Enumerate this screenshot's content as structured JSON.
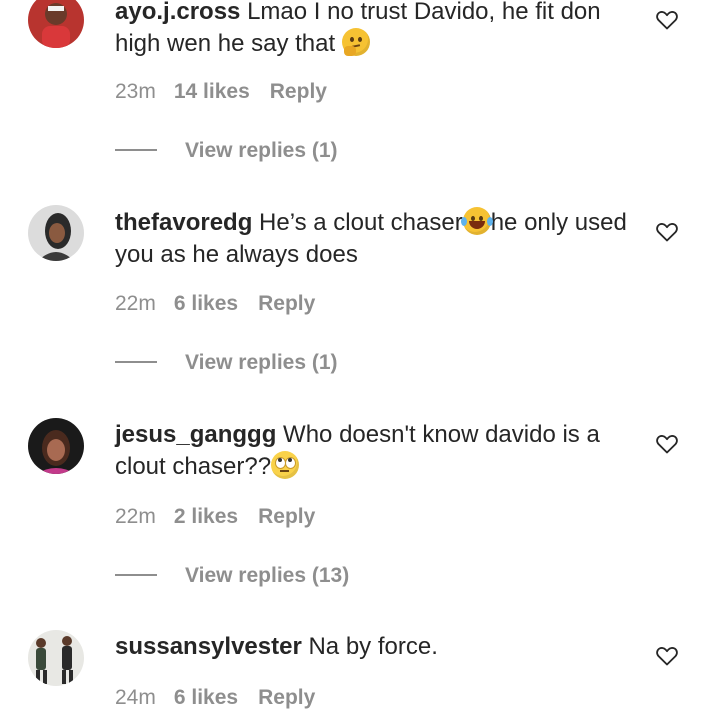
{
  "comments": [
    {
      "username": "ayo.j.cross",
      "text": "Lmao I no trust Davido, he fit don high wen he say that",
      "emoji": "thinking-face",
      "time": "23m",
      "likes": "14 likes",
      "reply": "Reply",
      "view_replies": "View replies (1)"
    },
    {
      "username": "thefavoredg",
      "text_before": "He’s a clout chaser",
      "emoji": "tears-of-joy",
      "text_after": "he only used you as he always does",
      "time": "22m",
      "likes": "6 likes",
      "reply": "Reply",
      "view_replies": "View replies (1)"
    },
    {
      "username": "jesus_ganggg",
      "text": "Who doesn't know davido is a clout chaser??",
      "emoji": "face-with-rolling-eyes",
      "time": "22m",
      "likes": "2 likes",
      "reply": "Reply",
      "view_replies": "View replies (13)"
    },
    {
      "username": "sussansylvester",
      "text": "Na by force.",
      "time": "24m",
      "likes": "6 likes",
      "reply": "Reply"
    }
  ],
  "icons": {
    "like": "heart-outline-icon"
  },
  "colors": {
    "text": "#262626",
    "secondary": "#8e8e8e",
    "background": "#ffffff"
  }
}
